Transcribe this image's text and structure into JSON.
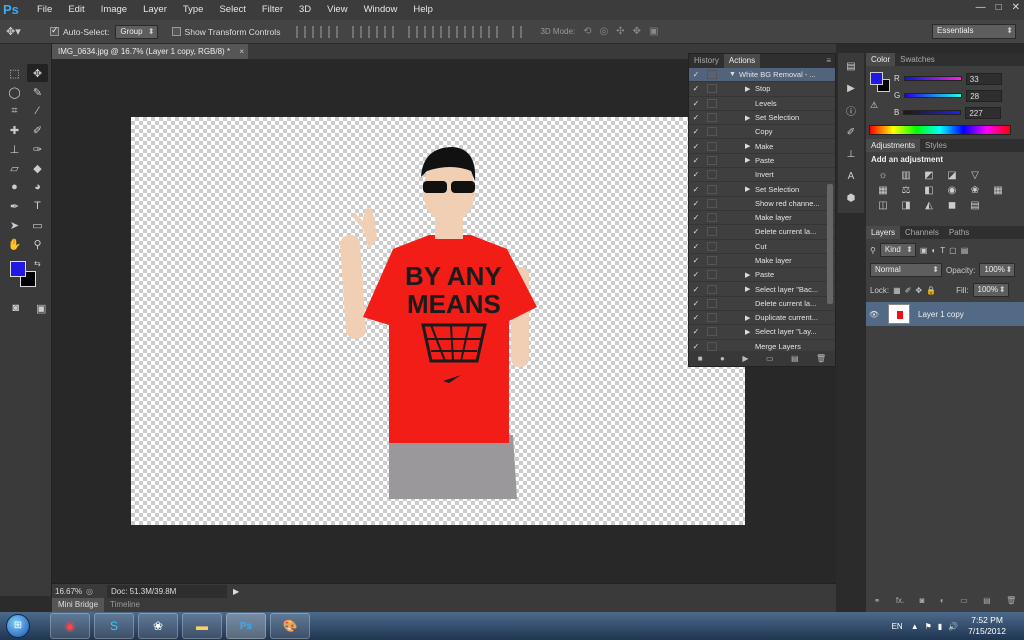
{
  "app": {
    "logo": "Ps",
    "menus": [
      "File",
      "Edit",
      "Image",
      "Layer",
      "Type",
      "Select",
      "Filter",
      "3D",
      "View",
      "Window",
      "Help"
    ],
    "window_controls": [
      "—",
      "□",
      "✕"
    ]
  },
  "options_bar": {
    "auto_select_label": "Auto-Select:",
    "auto_select_value": "Group",
    "show_transform_label": "Show Transform Controls",
    "mode_3d_label": "3D Mode:",
    "workspace": "Essentials"
  },
  "document": {
    "tab_title": "IMG_0634.jpg @ 16.7% (Layer 1 copy, RGB/8) *",
    "tab_close": "×",
    "zoom": "16.67%",
    "doc_info": "Doc: 51.3M/39.8M"
  },
  "bottom_tabs": [
    "Mini Bridge",
    "Timeline"
  ],
  "actions_panel": {
    "tabs": [
      "History",
      "Actions"
    ],
    "rows": [
      {
        "label": "White BG Removal - ...",
        "expanded": true,
        "indent": 0
      },
      {
        "label": "Stop",
        "expand": true,
        "indent": 1
      },
      {
        "label": "Levels",
        "expand": false,
        "indent": 1
      },
      {
        "label": "Set Selection",
        "expand": true,
        "indent": 1
      },
      {
        "label": "Copy",
        "expand": false,
        "indent": 1
      },
      {
        "label": "Make",
        "expand": true,
        "indent": 1
      },
      {
        "label": "Paste",
        "expand": true,
        "indent": 1
      },
      {
        "label": "Invert",
        "expand": false,
        "indent": 1
      },
      {
        "label": "Set Selection",
        "expand": true,
        "indent": 1
      },
      {
        "label": "Show red channe...",
        "expand": false,
        "indent": 1
      },
      {
        "label": "Make layer",
        "expand": false,
        "indent": 1
      },
      {
        "label": "Delete current la...",
        "expand": false,
        "indent": 1
      },
      {
        "label": "Cut",
        "expand": false,
        "indent": 1
      },
      {
        "label": "Make layer",
        "expand": false,
        "indent": 1
      },
      {
        "label": "Paste",
        "expand": true,
        "indent": 1
      },
      {
        "label": "Select layer \"Bac...",
        "expand": true,
        "indent": 1
      },
      {
        "label": "Delete current la...",
        "expand": false,
        "indent": 1
      },
      {
        "label": "Duplicate current...",
        "expand": true,
        "indent": 1
      },
      {
        "label": "Select layer \"Lay...",
        "expand": true,
        "indent": 1
      },
      {
        "label": "Merge Layers",
        "expand": false,
        "indent": 1
      }
    ]
  },
  "color_panel": {
    "tabs": [
      "Color",
      "Swatches"
    ],
    "channels": [
      {
        "label": "R",
        "value": "33"
      },
      {
        "label": "G",
        "value": "28"
      },
      {
        "label": "B",
        "value": "227"
      }
    ],
    "foreground": "#2118e3",
    "background": "#000000"
  },
  "adjustments_panel": {
    "tabs": [
      "Adjustments",
      "Styles"
    ],
    "title": "Add an adjustment"
  },
  "layers_panel": {
    "tabs": [
      "Layers",
      "Channels",
      "Paths"
    ],
    "kind_label": "Kind",
    "blend_mode": "Normal",
    "opacity_label": "Opacity:",
    "opacity_value": "100%",
    "lock_label": "Lock:",
    "fill_label": "Fill:",
    "fill_value": "100%",
    "layers": [
      {
        "name": "Layer 1 copy",
        "visible": true,
        "selected": true
      }
    ]
  },
  "taskbar": {
    "language": "EN",
    "time": "7:52 PM",
    "date": "7/15/2012"
  }
}
